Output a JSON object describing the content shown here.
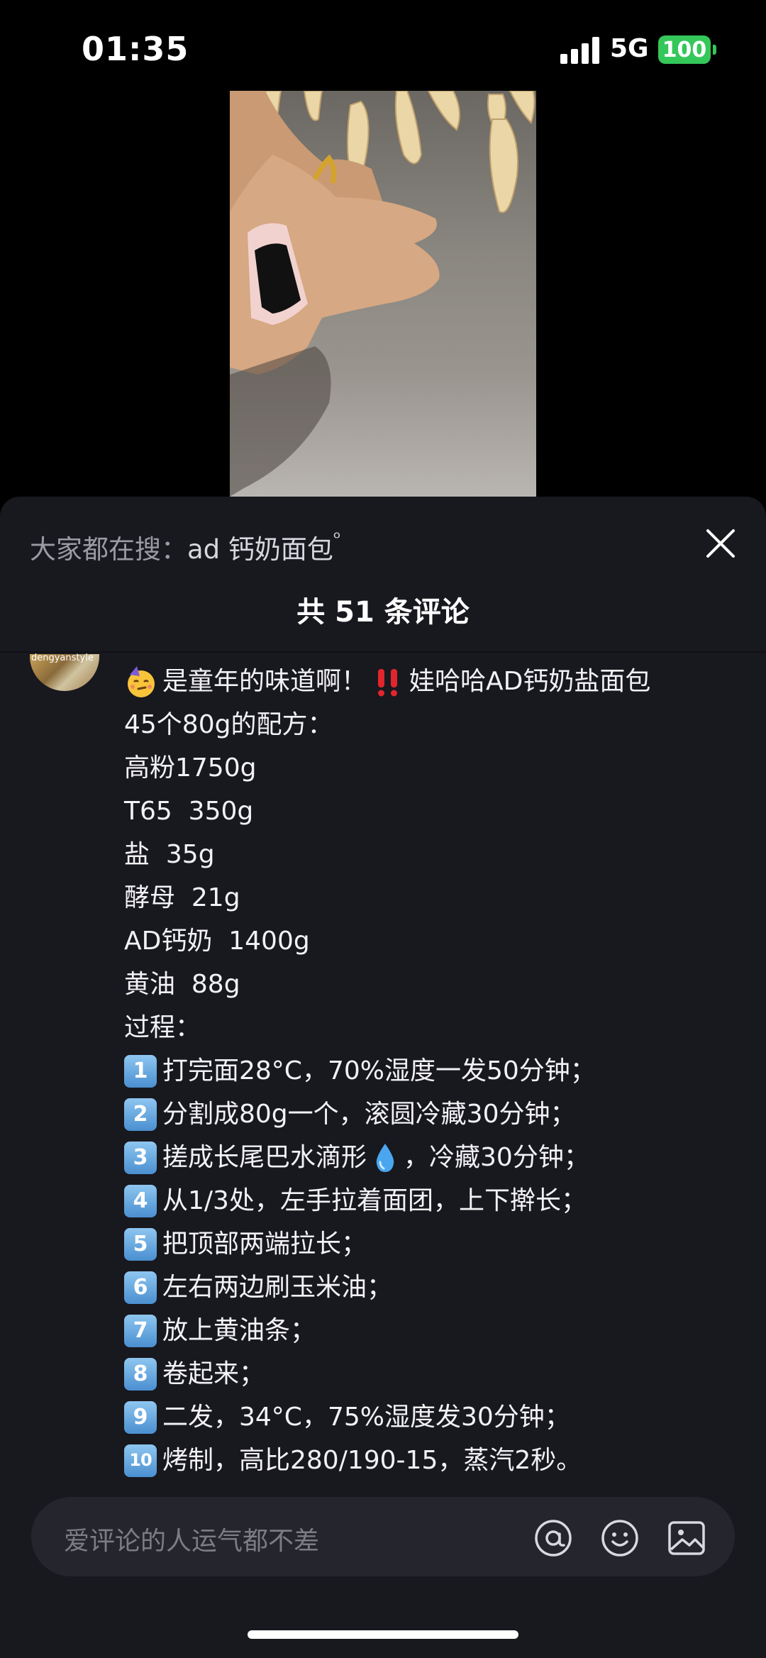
{
  "status_bar": {
    "time": "01:35",
    "network": "5G",
    "battery": "100"
  },
  "search": {
    "prefix": "大家都在搜：",
    "term": "ad 钙奶面包"
  },
  "comments_header": {
    "count_text": "共 51 条评论"
  },
  "comment": {
    "avatar_text": "dengyanstyle",
    "lines": [
      "是童年的味道啊！",
      "娃哈哈AD钙奶盐面包",
      "45个80g的配方：",
      "高粉1750g",
      "T65  350g",
      "盐  35g",
      "酵母  21g",
      "AD钙奶  1400g",
      "黄油  88g",
      "过程："
    ],
    "steps": [
      {
        "badge": "1",
        "text": "打完面28°C，70%湿度一发50分钟；"
      },
      {
        "badge": "2",
        "text": "分割成80g一个，滚圆冷藏30分钟；"
      },
      {
        "badge": "3",
        "text": "搓成长尾巴水滴形",
        "after": "，冷藏30分钟；"
      },
      {
        "badge": "4",
        "text": "从1/3处，左手拉着面团，上下擀长；"
      },
      {
        "badge": "5",
        "text": "把顶部两端拉长；"
      },
      {
        "badge": "6",
        "text": "左右两边刷玉米油；"
      },
      {
        "badge": "7",
        "text": "放上黄油条；"
      },
      {
        "badge": "8",
        "text": "卷起来；"
      },
      {
        "badge": "9",
        "text": "二发，34°C，75%湿度发30分钟；"
      },
      {
        "badge": "10",
        "text": "烤制，高比280/190-15，蒸汽2秒。"
      }
    ]
  },
  "input": {
    "placeholder": "爱评论的人运气都不差"
  },
  "colors": {
    "panel_bg": "#18181f",
    "input_bg": "#25252d",
    "battery": "#34c759",
    "badge": "#4a8fd0"
  }
}
